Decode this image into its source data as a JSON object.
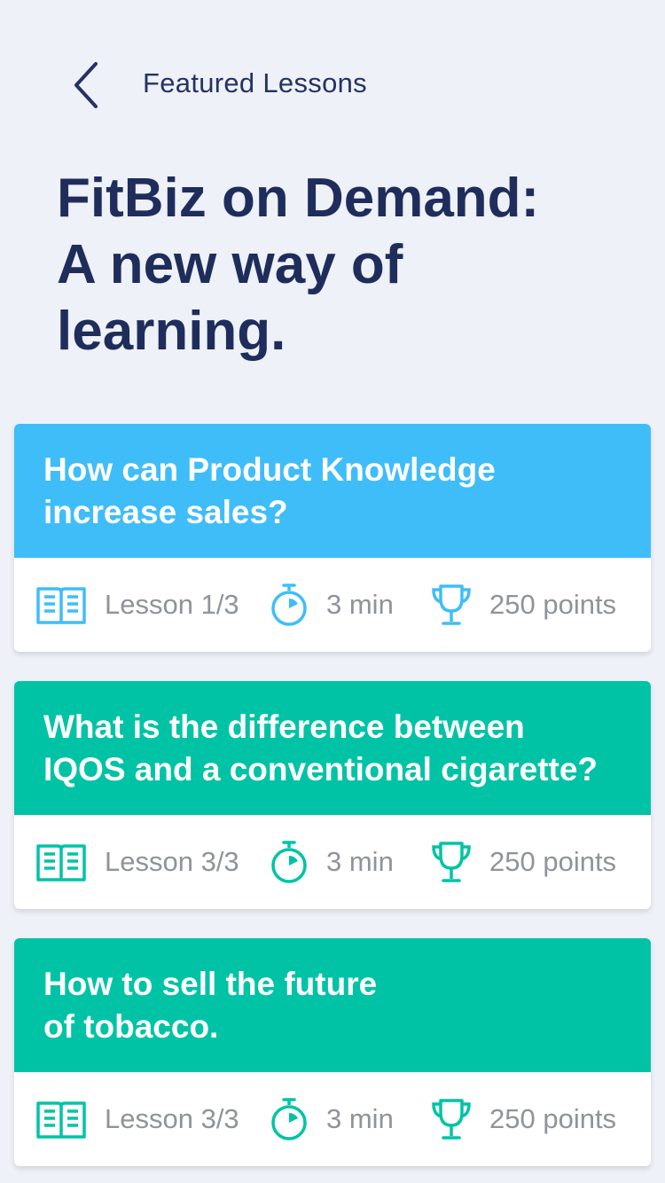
{
  "header": {
    "back_label": "Back",
    "title": "Featured Lessons"
  },
  "page": {
    "title_lines": [
      "FitBiz on Demand:",
      "A new way of",
      "learning."
    ]
  },
  "colors": {
    "blue": "#3fbdf9",
    "teal": "#00c3a6",
    "navy": "#1f2d5c",
    "meta_text": "#8f939a"
  },
  "lessons": [
    {
      "title_lines": [
        "How can Product Knowledge",
        "increase sales?"
      ],
      "lesson": "Lesson 1/3",
      "duration": "3 min",
      "points": "250 points",
      "accent": "#3fbdf9"
    },
    {
      "title_lines": [
        "What is the difference between",
        "IQOS and a conventional cigarette?"
      ],
      "lesson": "Lesson 3/3",
      "duration": "3 min",
      "points": "250 points",
      "accent": "#00c3a6"
    },
    {
      "title_lines": [
        "How to sell the future",
        "of tobacco."
      ],
      "lesson": "Lesson 3/3",
      "duration": "3 min",
      "points": "250 points",
      "accent": "#00c3a6"
    }
  ],
  "icons": {
    "back": "chevron-left-icon",
    "lesson": "book-icon",
    "duration": "stopwatch-icon",
    "points": "trophy-icon"
  }
}
